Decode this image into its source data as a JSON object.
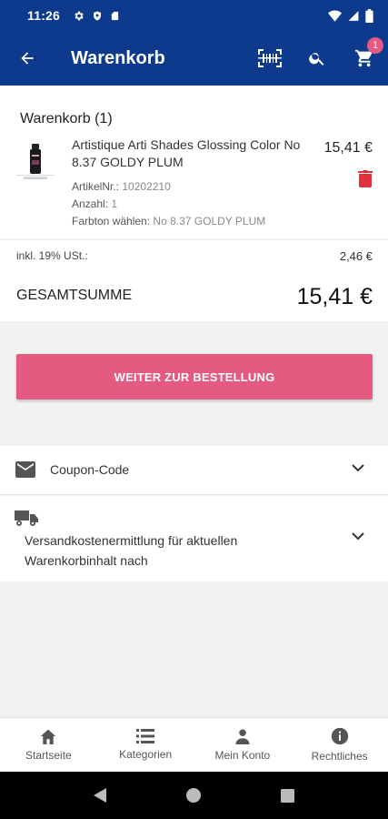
{
  "status_bar": {
    "time": "11:26"
  },
  "app_bar": {
    "title": "Warenkorb",
    "cart_count": "1",
    "icons": [
      "back-arrow-icon",
      "barcode-scan-icon",
      "search-icon",
      "cart-icon"
    ]
  },
  "cart": {
    "heading": "Warenkorb (1)",
    "item": {
      "name": "Artistique Arti Shades Glossing Color No 8.37 GOLDY PLUM",
      "price": "15,41 €",
      "article_label": "ArtikelNr.:",
      "article_value": "10202210",
      "quantity_label": "Anzahl:",
      "quantity_value": "1",
      "shade_label": "Farbton wählen:",
      "shade_value": "No 8.37 GOLDY PLUM"
    }
  },
  "summary": {
    "tax_label": "inkl. 19% USt.:",
    "tax_value": "2,46 €",
    "total_label": "GESAMTSUMME",
    "total_value": "15,41 €"
  },
  "checkout_button": "WEITER ZUR BESTELLUNG",
  "coupon": {
    "label": "Coupon-Code"
  },
  "shipping": {
    "label": "Versandkostenermittlung für aktuellen Warenkorbinhalt nach"
  },
  "bottom_nav": [
    {
      "label": "Startseite",
      "icon": "home-icon"
    },
    {
      "label": "Kategorien",
      "icon": "list-icon"
    },
    {
      "label": "Mein Konto",
      "icon": "person-icon"
    },
    {
      "label": "Rechtliches",
      "icon": "info-icon"
    }
  ],
  "colors": {
    "primary": "#0d3a8c",
    "accent": "#e55a80",
    "delete": "#e0323e"
  }
}
